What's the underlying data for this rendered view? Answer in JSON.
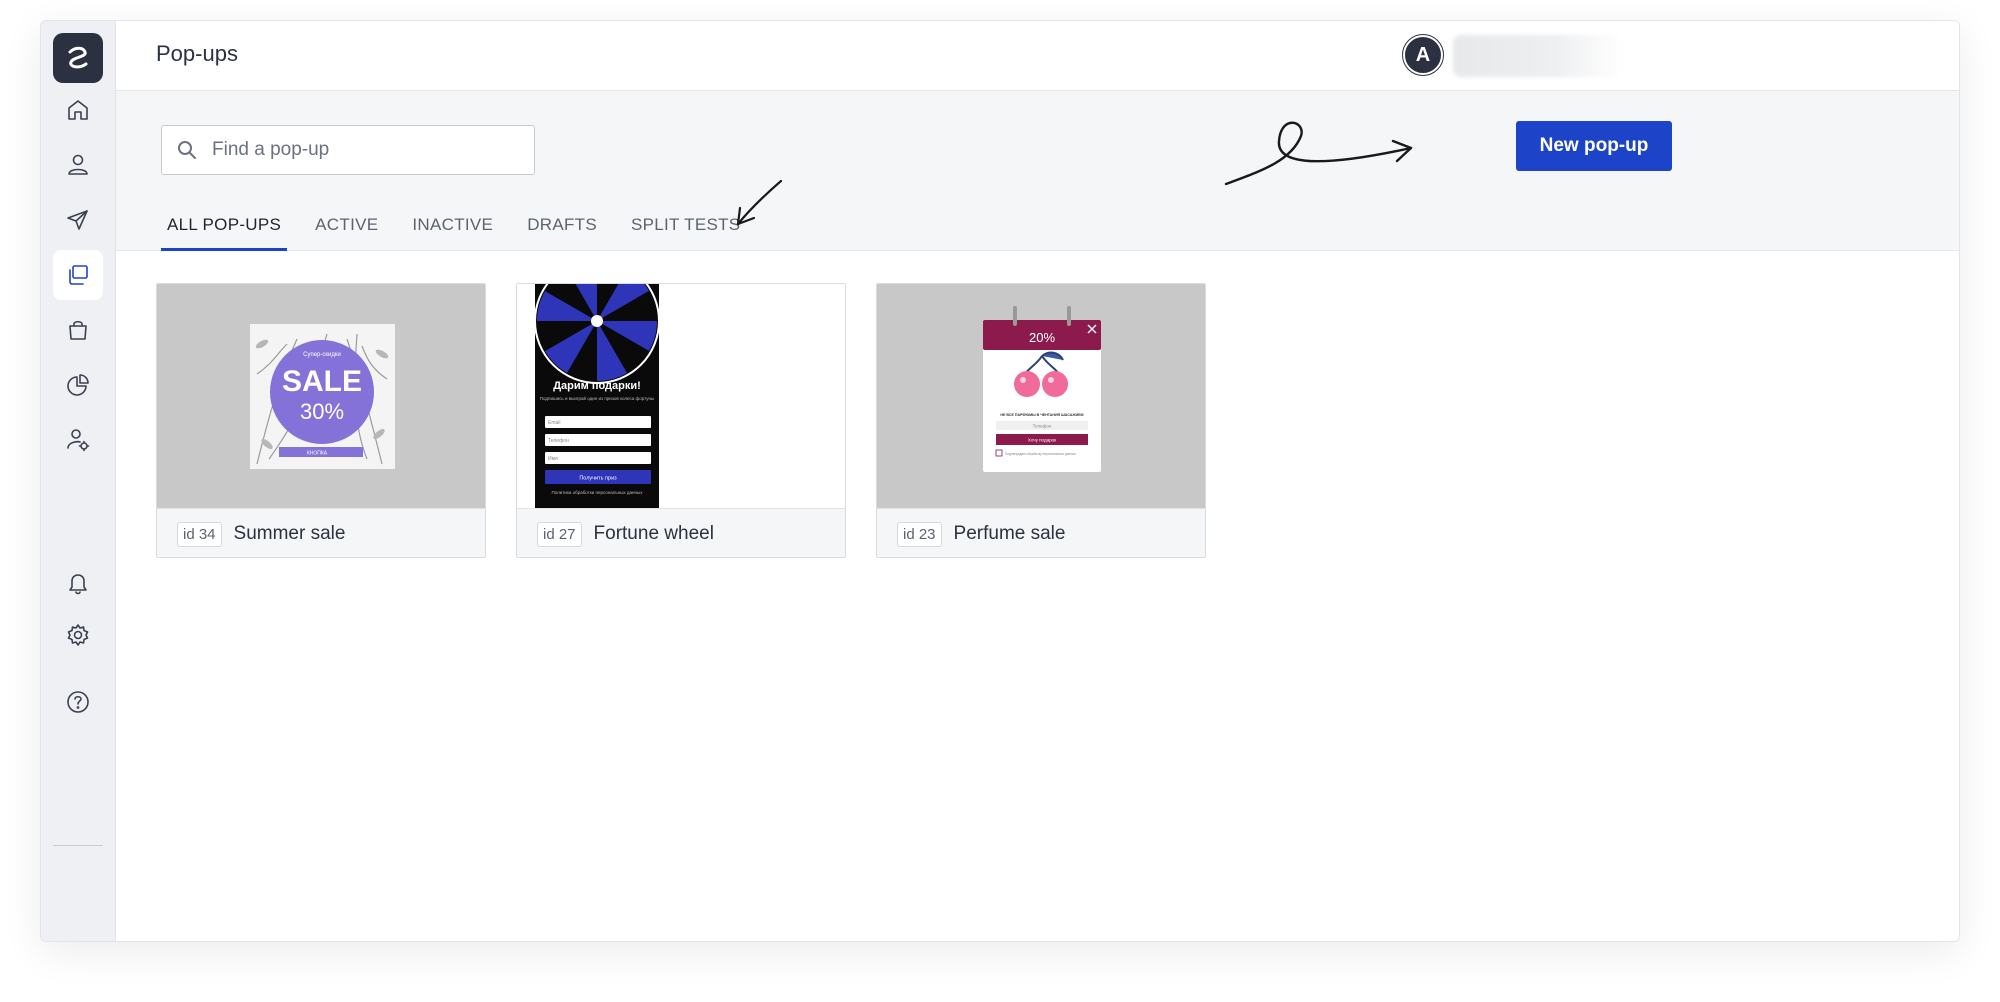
{
  "app": {
    "page_title": "Pop-ups",
    "avatar_letter": "A"
  },
  "sidebar": {
    "items": [
      {
        "icon": "home-icon"
      },
      {
        "icon": "user-icon"
      },
      {
        "icon": "send-icon"
      },
      {
        "icon": "popups-icon",
        "active": true
      },
      {
        "icon": "bag-icon"
      },
      {
        "icon": "pie-chart-icon"
      },
      {
        "icon": "user-settings-icon"
      },
      {
        "icon": "bell-icon"
      },
      {
        "icon": "gear-icon"
      },
      {
        "icon": "help-icon"
      }
    ]
  },
  "search": {
    "placeholder": "Find a pop-up",
    "value": ""
  },
  "toolbar": {
    "new_button_label": "New pop-up"
  },
  "tabs": [
    {
      "label": "ALL POP-UPS",
      "active": true
    },
    {
      "label": "ACTIVE"
    },
    {
      "label": "INACTIVE"
    },
    {
      "label": "DRAFTS"
    },
    {
      "label": "SPLIT TESTS"
    }
  ],
  "cards": [
    {
      "id_label": "id 34",
      "name": "Summer sale",
      "preview": {
        "small_text": "Супер-скидки",
        "big_text": "SALE",
        "percent": "30%",
        "button": "КНОПКА"
      }
    },
    {
      "id_label": "id 27",
      "name": "Fortune wheel",
      "preview": {
        "heading": "Дарим подарки!",
        "subtext": "Подпишись и выиграй один из призов колеса фортуны",
        "field1": "Email",
        "field2": "Телефон",
        "field3": "Имя",
        "button": "Получить приз",
        "footer": "Политика обработки персональных данных"
      }
    },
    {
      "id_label": "id 23",
      "name": "Perfume sale",
      "preview": {
        "percent": "20%",
        "text": "НЕ ВСЕ ПАРФЮМЫ В ЧЕНТАНИЯ ШАСАЖИЕМ",
        "field": "Телефон",
        "button": "Хочу подарок",
        "consent": "Подтверждаю обработку персональных данных"
      }
    }
  ],
  "colors": {
    "accent": "#1d44c8",
    "sidebar_bg": "#eef0f3",
    "dark": "#2b3140",
    "summer_purple": "#8472d8",
    "wheel_blue": "#2f35b8",
    "perfume_berry": "#8c1a4c"
  }
}
